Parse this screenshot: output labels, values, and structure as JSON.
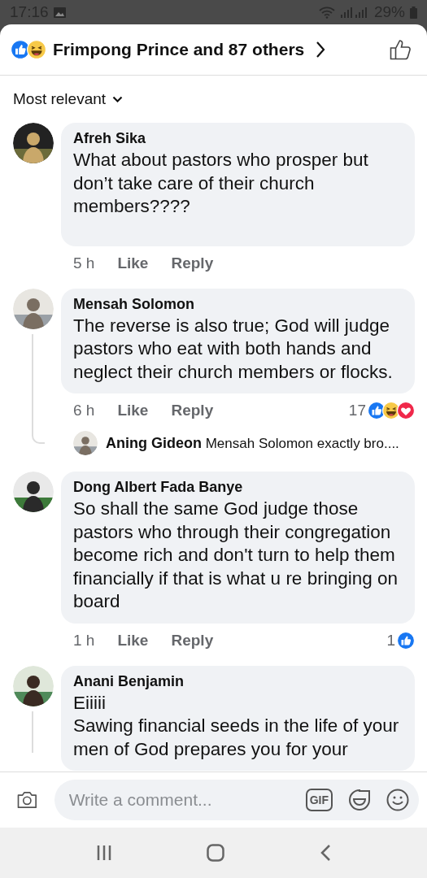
{
  "status_bar": {
    "time": "17:16",
    "battery": "29%"
  },
  "header": {
    "reactions": [
      {
        "kind": "like"
      },
      {
        "kind": "haha"
      }
    ],
    "title": "Frimpong Prince and 87 others"
  },
  "sort": {
    "label": "Most relevant"
  },
  "comments": [
    {
      "name": "Afreh Sika",
      "text": "What about pastors who prosper but don’t take care of their church members????",
      "time": "5 h",
      "like": "Like",
      "reply": "Reply",
      "thread_line": false
    },
    {
      "name": "Mensah Solomon",
      "text": "The reverse is also true; God will judge pastors who eat with both hands and neglect their church members or flocks.",
      "time": "6 h",
      "like": "Like",
      "reply": "Reply",
      "reaction_count": "17",
      "reactions": [
        {
          "kind": "like"
        },
        {
          "kind": "haha"
        },
        {
          "kind": "love"
        }
      ],
      "thread_line": true,
      "replies": [
        {
          "name": "Aning Gideon",
          "text": "Mensah Solomon exactly bro...."
        }
      ]
    },
    {
      "name": "Dong Albert Fada Banye",
      "text": "So shall the same God judge those pastors who through their congregation become rich and don't turn to help them financially  if that is what u re bringing on board",
      "time": "1 h",
      "like": "Like",
      "reply": "Reply",
      "reaction_count": "1",
      "reactions": [
        {
          "kind": "like"
        }
      ],
      "thread_line": false
    },
    {
      "name": "Anani Benjamin",
      "text": "Eiiiii\nSawing financial seeds in the life of your men of God prepares you for your",
      "thread_line": true
    }
  ],
  "composer": {
    "placeholder": "Write a comment...",
    "gif_label": "GIF"
  }
}
